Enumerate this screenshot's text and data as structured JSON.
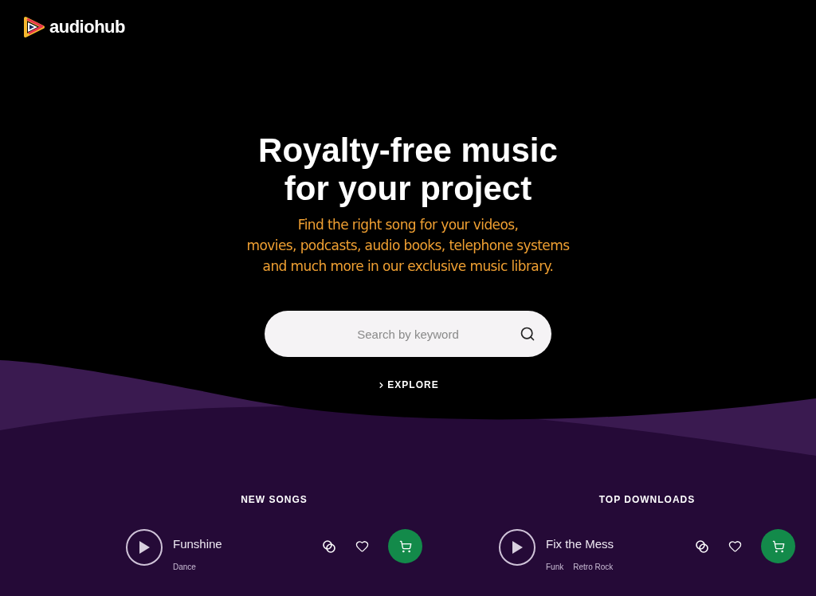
{
  "logo": {
    "name": "audiohub"
  },
  "hero": {
    "title_lines": [
      "Royalty-free music",
      "for your project"
    ],
    "subtitle_lines": [
      "Find the right song for your videos,",
      "movies, podcasts, audio books, telephone systems",
      "and much more in our exclusive music library."
    ]
  },
  "search": {
    "placeholder": "Search by keyword"
  },
  "explore": {
    "label": "EXPLORE"
  },
  "sections": [
    {
      "title": "NEW SONGS",
      "songs": [
        {
          "title": "Funshine",
          "genres": [
            "Dance"
          ],
          "liked": false
        }
      ]
    },
    {
      "title": "TOP DOWNLOADS",
      "songs": [
        {
          "title": "Fix the Mess",
          "genres": [
            "Funk",
            "Retro Rock"
          ],
          "liked": false
        }
      ]
    }
  ]
}
